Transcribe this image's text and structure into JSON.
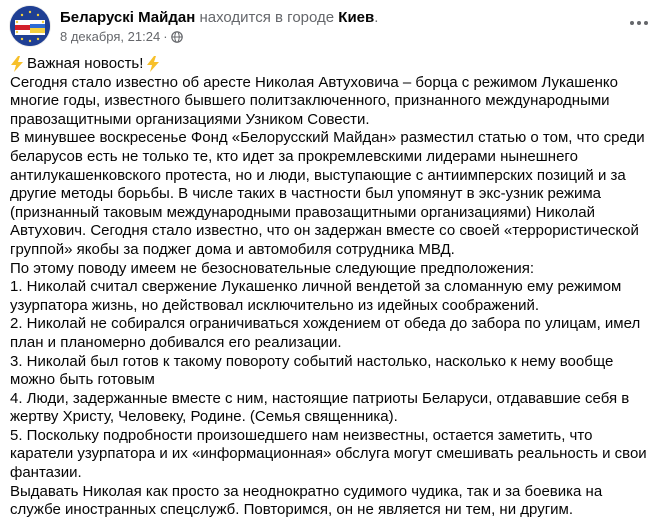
{
  "post": {
    "page_name": "Беларускі Майдан",
    "location_prefix": "находится в городе",
    "city": "Киев",
    "location_suffix": ".",
    "date": "8 декабря, 21:24",
    "separator": "·",
    "privacy_icon": "globe-icon",
    "more_icon": "more-options-icon",
    "headline_icon": "lightning-bolt-icon",
    "headline": "Важная новость!",
    "paragraphs": [
      "Сегодня стало известно об аресте Николая Автуховича – борца с режимом Лукашенко многие годы, известного бывшего политзаключенного, признанного международными правозащитными организациями Узником Совести.",
      "В минувшее воскресенье Фонд «Белорусский Майдан» разместил статью о том, что среди беларусов есть не только те, кто идет за прокремлевскими лидерами нынешнего антилукашенковского протеста, но и люди, выступающие с антиимперских позиций и за другие методы борьбы. В числе таких в частности был упомянут в экс-узник режима (признанный таковым международными правозащитными организациями) Николай Автухович. Сегодня стало известно, что он задержан вместе со своей «террористической группой» якобы за поджег дома и автомобиля сотрудника МВД.",
      "По этому поводу имеем не безосновательные следующие предположения:",
      "1. Николай считал свержение Лукашенко личной вендетой за сломанную ему режимом узурпатора жизнь, но действовал исключительно из идейных соображений.",
      "2. Николай не собирался ограничиваться хождением от обеда до забора по улицам, имел план и планомерно добивался его реализации.",
      "3. Николай был готов к такому повороту событий настолько, насколько к нему вообще можно быть готовым",
      "4. Люди, задержанные вместе с ним, настоящие патриоты Беларуси, отдававшие себя в жертву Христу, Человеку, Родине. (Семья священника).",
      "5. Поскольку подробности произошедшего нам неизвестны, остается заметить, что каратели узурпатора и их «информационная» обслуга могут смешивать реальность и свои фантазии.",
      "Выдавать Николая как просто за неоднократно судимого чудика, так и за боевика на службе иностранных спецслужб. Повторимся, он не является ни тем, ни другим."
    ]
  }
}
